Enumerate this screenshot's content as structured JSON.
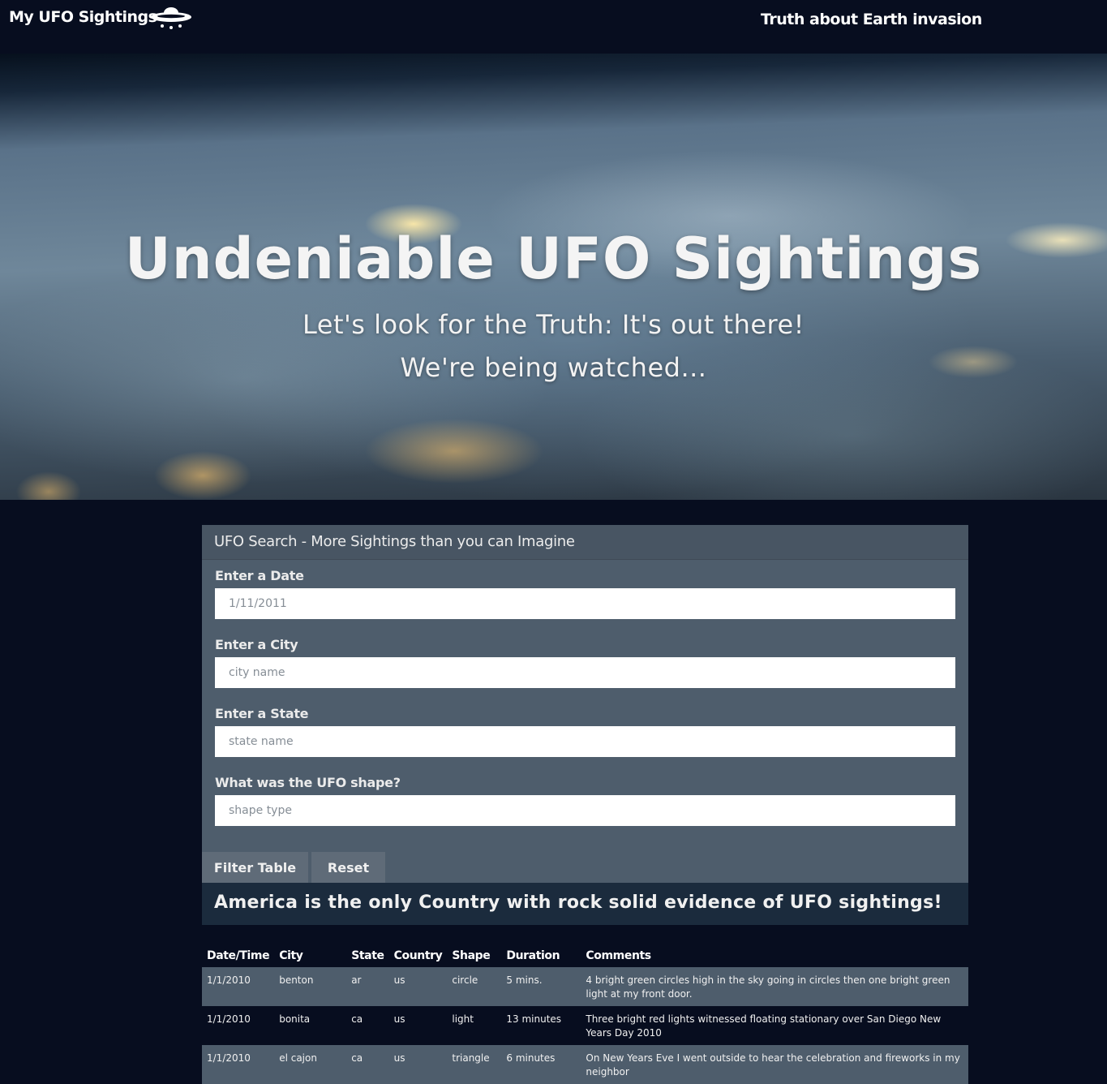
{
  "nav": {
    "brand": "My UFO Sightings",
    "brand_icon": "ufo-icon",
    "link": "Truth about Earth invasion"
  },
  "hero": {
    "title": "Undeniable UFO Sightings",
    "subtitle1": "Let's look for the Truth: It's out there!",
    "subtitle2": "We're being watched..."
  },
  "filter": {
    "title": "UFO Search - More Sightings than you can Imagine",
    "date_label": "Enter a Date",
    "date_placeholder": "1/11/2011",
    "city_label": "Enter a City",
    "city_placeholder": "city name",
    "state_label": "Enter a State",
    "state_placeholder": "state name",
    "shape_label": "What was the UFO shape?",
    "shape_placeholder": "shape type",
    "filter_button": "Filter Table",
    "reset_button": "Reset"
  },
  "banner": {
    "text": "America is the only Country with rock solid evidence of UFO sightings!"
  },
  "table": {
    "headers": [
      "Date/Time",
      "City",
      "State",
      "Country",
      "Shape",
      "Duration",
      "Comments"
    ],
    "rows": [
      [
        "1/1/2010",
        "benton",
        "ar",
        "us",
        "circle",
        "5 mins.",
        "4 bright green circles high in the sky going in circles then one bright green light at my front door."
      ],
      [
        "1/1/2010",
        "bonita",
        "ca",
        "us",
        "light",
        "13 minutes",
        "Three bright red lights witnessed floating stationary over San Diego New Years Day 2010"
      ],
      [
        "1/1/2010",
        "el cajon",
        "ca",
        "us",
        "triangle",
        "6 minutes",
        "On New Years Eve I went outside to hear the celebration and fireworks in my neighbor"
      ]
    ]
  }
}
